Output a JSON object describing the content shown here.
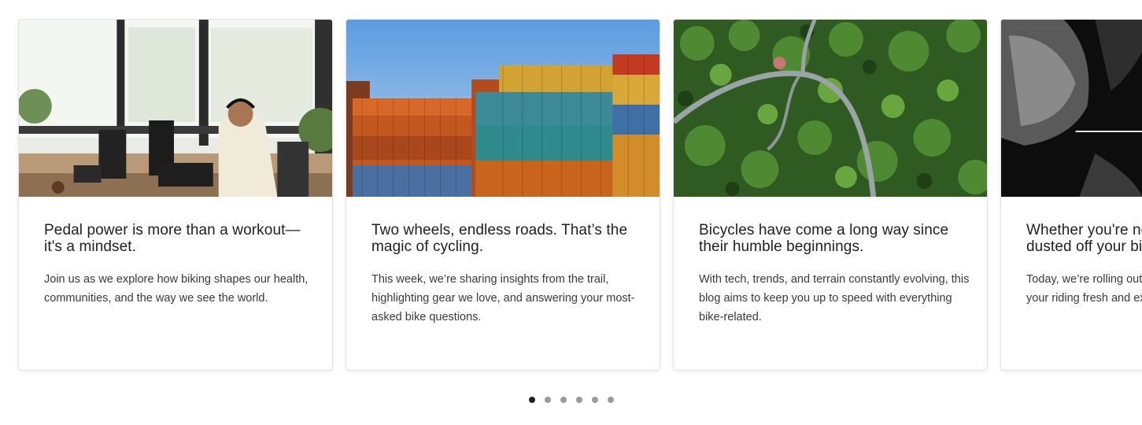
{
  "carousel": {
    "cards": [
      {
        "image": "office-man-with-headphones-photo",
        "title": "Pedal power is more than a workout—it's a mindset.",
        "text": "Join us as we explore how biking shapes our health, communities, and the way we see the world."
      },
      {
        "image": "stacked-shipping-containers-photo",
        "title": "Two wheels, endless roads. That’s the magic of cycling.",
        "text": "This week, we’re sharing insights from the trail, highlighting gear we love, and answering your most-asked bike questions."
      },
      {
        "image": "aerial-forest-road-photo",
        "title": "Bicycles have come a long way since their humble beginnings.",
        "text": "With tech, trends, and terrain constantly evolving, this blog aims to keep you up to speed with everything bike-related."
      },
      {
        "image": "black-and-white-cyclist-photo",
        "title": "Whether you're new to cycling or just dusted off your bike after years",
        "text": "Today, we’re rolling out our latest reviews to keep your riding fresh and exciting."
      }
    ],
    "pagination": {
      "total": 6,
      "active": 0
    }
  }
}
